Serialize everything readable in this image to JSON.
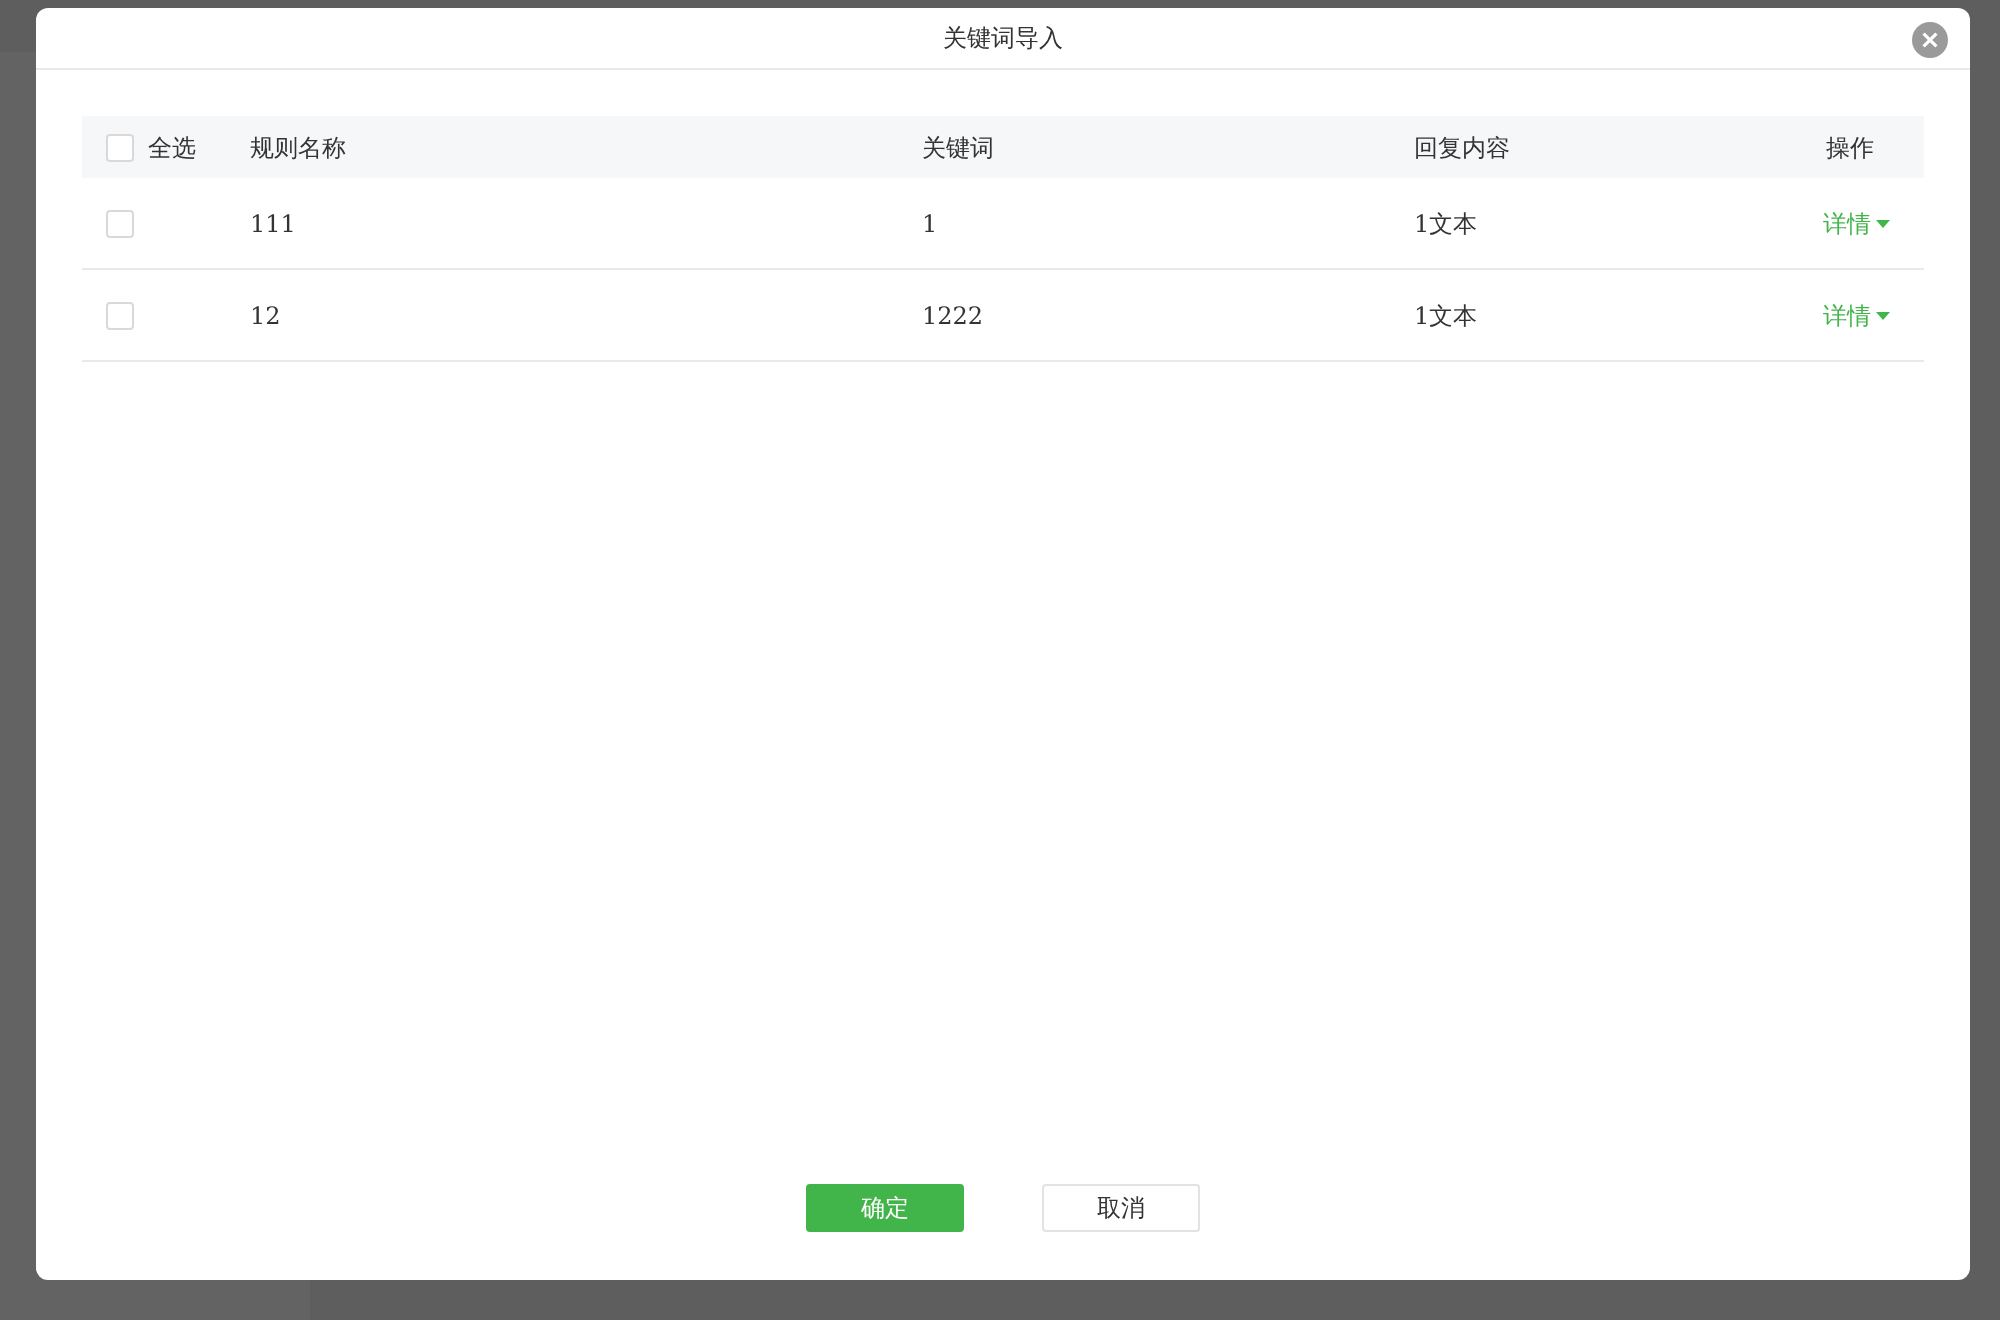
{
  "dialog": {
    "title": "关键词导入",
    "table": {
      "select_all": {
        "label": "全选",
        "checked": false
      },
      "columns": [
        "规则名称",
        "关键词",
        "回复内容",
        "操作"
      ],
      "rows": [
        {
          "checked": false,
          "cells": [
            "111",
            "1",
            "1文本"
          ],
          "action": "详情"
        },
        {
          "checked": false,
          "cells": [
            "12",
            "1222",
            "1文本"
          ],
          "action": "详情"
        }
      ]
    },
    "buttons": [
      {
        "label": "确定",
        "kind": "primary"
      },
      {
        "label": "取消",
        "kind": "secondary"
      }
    ]
  }
}
